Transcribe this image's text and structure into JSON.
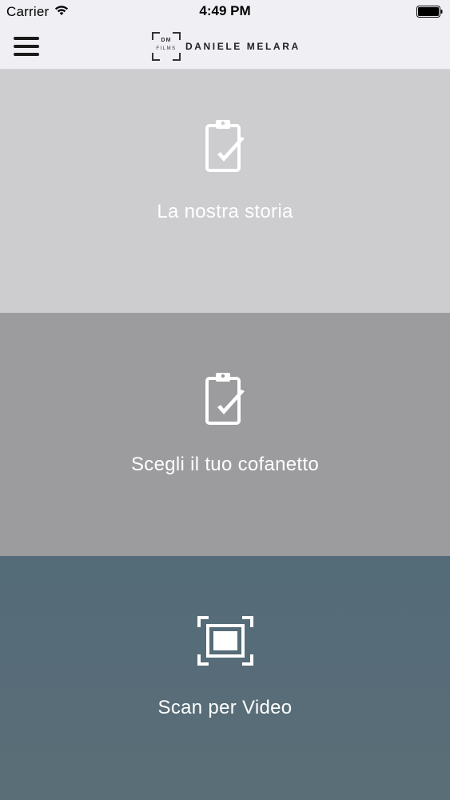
{
  "status_bar": {
    "carrier": "Carrier",
    "time": "4:49 PM",
    "wifi_icon": "wifi-icon",
    "battery_icon": "battery-icon"
  },
  "nav": {
    "menu_icon": "hamburger-menu-icon",
    "logo_monogram": "DM",
    "logo_sub": "FILMS",
    "brand_name": "DANIELE MELARA"
  },
  "tiles": [
    {
      "label": "La nostra storia",
      "icon": "clipboard-check-icon",
      "bg": "#cdcccf"
    },
    {
      "label": "Scegli il tuo cofanetto",
      "icon": "clipboard-check-icon",
      "bg": "#9c9b9d"
    },
    {
      "label": "Scan per Video",
      "icon": "scan-frame-icon",
      "bg": "#546b78"
    }
  ],
  "colors": {
    "bar_bg": "#efeff4",
    "text_on_tile": "#ffffff"
  }
}
